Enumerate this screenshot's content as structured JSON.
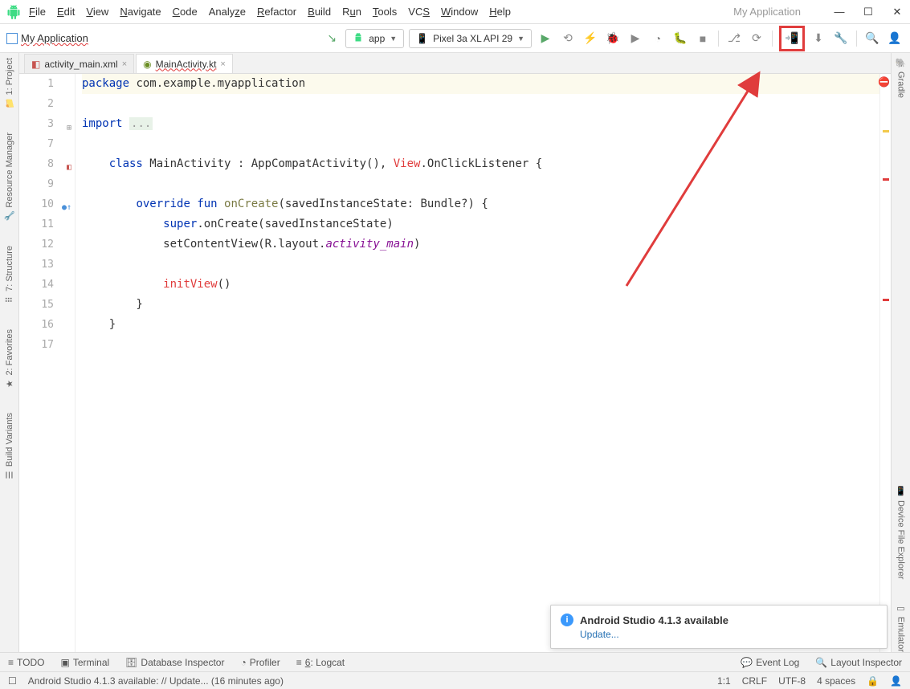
{
  "title": {
    "app_name": "My Application"
  },
  "menu": [
    "File",
    "Edit",
    "View",
    "Navigate",
    "Code",
    "Analyze",
    "Refactor",
    "Build",
    "Run",
    "Tools",
    "VCS",
    "Window",
    "Help"
  ],
  "window_controls": {
    "min": "—",
    "max": "☐",
    "close": "✕"
  },
  "toolbar": {
    "project_name": "My Application",
    "run_config": "app",
    "device": "Pixel 3a XL API 29"
  },
  "tabs": [
    {
      "label": "activity_main.xml",
      "active": false
    },
    {
      "label": "MainActivity.kt",
      "active": true
    }
  ],
  "code": {
    "lines": [
      {
        "n": 1,
        "html": "<span class='kw'>package</span> com.example.myapplication",
        "hl": true
      },
      {
        "n": 2,
        "html": ""
      },
      {
        "n": 3,
        "html": "<span class='kw'>import</span> <span class='fold'>...</span>"
      },
      {
        "n": 7,
        "html": ""
      },
      {
        "n": 8,
        "html": "    <span class='kw'>class</span> MainActivity : AppCompatActivity(), <span class='red'>View</span>.OnClickListener {"
      },
      {
        "n": 9,
        "html": ""
      },
      {
        "n": 10,
        "html": "        <span class='kw'>override</span> <span class='kw'>fun</span> <span class='fnname'>onCreate</span>(savedInstanceState: Bundle?) {"
      },
      {
        "n": 11,
        "html": "            <span class='kw'>super</span>.onCreate(savedInstanceState)"
      },
      {
        "n": 12,
        "html": "            setContentView(R.layout.<span class='purple'>activity_main</span>)"
      },
      {
        "n": 13,
        "html": ""
      },
      {
        "n": 14,
        "html": "            <span class='red'>initView</span>()"
      },
      {
        "n": 15,
        "html": "        }"
      },
      {
        "n": 16,
        "html": "    }"
      },
      {
        "n": 17,
        "html": ""
      }
    ]
  },
  "left_tabs": [
    {
      "label": "1: Project",
      "icon": "📁"
    },
    {
      "label": "Resource Manager",
      "icon": "🔧"
    },
    {
      "label": "7: Structure",
      "icon": "⠿"
    },
    {
      "label": "2: Favorites",
      "icon": "★"
    },
    {
      "label": "Build Variants",
      "icon": "☰"
    }
  ],
  "right_tabs": [
    {
      "label": "Gradle",
      "icon": "🐘"
    },
    {
      "label": "Device File Explorer",
      "icon": "📱"
    },
    {
      "label": "Emulator",
      "icon": "▭"
    }
  ],
  "notification": {
    "title": "Android Studio 4.1.3 available",
    "link": "Update..."
  },
  "bottom_items": [
    {
      "label": "TODO",
      "icon": "≡"
    },
    {
      "label": "Terminal",
      "icon": "▣"
    },
    {
      "label": "Database Inspector",
      "icon": "🗄"
    },
    {
      "label": "Profiler",
      "icon": "◔"
    },
    {
      "label": "6: Logcat",
      "icon": "≡"
    }
  ],
  "bottom_right": [
    {
      "label": "Event Log",
      "icon": "💬"
    },
    {
      "label": "Layout Inspector",
      "icon": "🔍"
    }
  ],
  "status": {
    "message": "Android Studio 4.1.3 available: // Update... (16 minutes ago)",
    "pos": "1:1",
    "sep": "CRLF",
    "enc": "UTF-8",
    "indent": "4 spaces"
  }
}
